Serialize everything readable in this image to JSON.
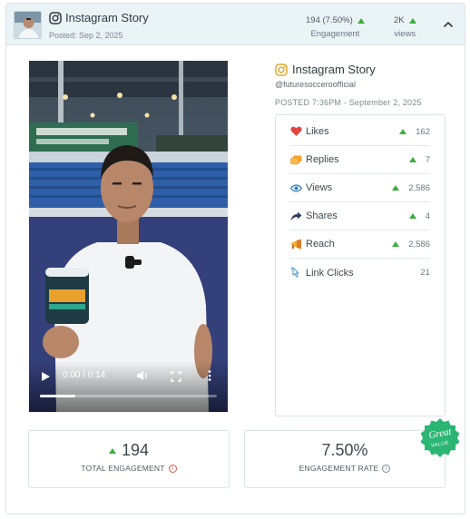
{
  "header": {
    "title": "Instagram Story",
    "posted": "Posted: Sep 2, 2025",
    "engagement_value": "194 (7.50%)",
    "engagement_label": "Engagement",
    "views_value": "2K",
    "views_label": "views"
  },
  "video": {
    "time": "0:00 / 0:14",
    "progress": 0.2
  },
  "post": {
    "title": "Instagram Story",
    "handle": "@futuresocceroofficial",
    "posted_time": "POSTED 7:36PM - September 2, 2025"
  },
  "metrics": [
    {
      "label": "Likes",
      "value": "162",
      "trend": "up",
      "icon": "heart-icon"
    },
    {
      "label": "Replies",
      "value": "7",
      "trend": "up",
      "icon": "replies-icon"
    },
    {
      "label": "Views",
      "value": "2,586",
      "trend": "up",
      "icon": "eye-icon"
    },
    {
      "label": "Shares",
      "value": "4",
      "trend": "up",
      "icon": "share-arrow-icon"
    },
    {
      "label": "Reach",
      "value": "2,586",
      "trend": "up",
      "icon": "megaphone-icon"
    },
    {
      "label": "Link Clicks",
      "value": "21",
      "trend": "none",
      "icon": "link-click-icon"
    }
  ],
  "summary": {
    "total_engagement_value": "194",
    "total_engagement_label": "TOTAL ENGAGEMENT",
    "engagement_rate_value": "7.50%",
    "engagement_rate_label": "ENGAGEMENT RATE",
    "badge_main": "Great",
    "badge_sub": "VALUE"
  },
  "colors": {
    "accent_green": "#3fae3f",
    "badge_green": "#2bb673",
    "instagram_gold": "#e0a72c",
    "header_bg": "#eaf3f6"
  }
}
